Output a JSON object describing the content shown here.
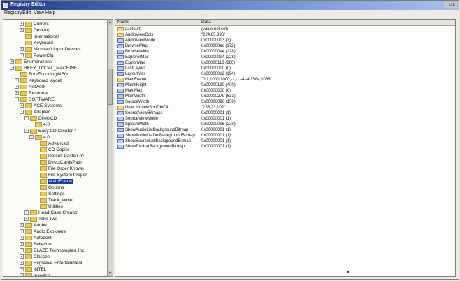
{
  "window": {
    "title": "Registry Editor",
    "caption_buttons": "_ □ x"
  },
  "menu": [
    "Registry",
    "Edit",
    "View",
    "Help"
  ],
  "tree": [
    {
      "label": "Current",
      "indent": 3,
      "exp": "+"
    },
    {
      "label": "Desktop",
      "indent": 3,
      "exp": "+"
    },
    {
      "label": "International",
      "indent": 3,
      "exp": ""
    },
    {
      "label": "Keyboard",
      "indent": 3,
      "exp": ""
    },
    {
      "label": "Microsoft Input Devices",
      "indent": 3,
      "exp": "+"
    },
    {
      "label": "PowerCfg",
      "indent": 3,
      "exp": "+"
    },
    {
      "label": "Enumerations",
      "indent": 1,
      "exp": "+"
    },
    {
      "label": "HKEY_LOCAL_MACHINE",
      "indent": 1,
      "exp": "-"
    },
    {
      "label": "FontEncodingINFO",
      "indent": 2,
      "exp": ""
    },
    {
      "label": "Keyboard layout",
      "indent": 2,
      "exp": "+"
    },
    {
      "label": "Network",
      "indent": 2,
      "exp": "+"
    },
    {
      "label": "Resource",
      "indent": 2,
      "exp": "+"
    },
    {
      "label": "SOFTWARE",
      "indent": 2,
      "exp": "-"
    },
    {
      "label": "ACE Systems",
      "indent": 3,
      "exp": "+"
    },
    {
      "label": "Adaptec",
      "indent": 3,
      "exp": "-"
    },
    {
      "label": "DirectCD",
      "indent": 4,
      "exp": "-"
    },
    {
      "label": "4.0",
      "indent": 5,
      "exp": ""
    },
    {
      "label": "Easy CD Creator 4",
      "indent": 4,
      "exp": "-"
    },
    {
      "label": "4.0",
      "indent": 5,
      "exp": "-"
    },
    {
      "label": "Advanced",
      "indent": 6,
      "exp": ""
    },
    {
      "label": "CD Copier",
      "indent": 6,
      "exp": ""
    },
    {
      "label": "Default Paste Loc",
      "indent": 6,
      "exp": ""
    },
    {
      "label": "DirectCardsPath",
      "indent": 6,
      "exp": ""
    },
    {
      "label": "File Order Known",
      "indent": 6,
      "exp": ""
    },
    {
      "label": "File System Proper",
      "indent": 6,
      "exp": ""
    },
    {
      "label": "MainFrame",
      "indent": 6,
      "exp": "",
      "selected": true
    },
    {
      "label": "Options",
      "indent": 6,
      "exp": ""
    },
    {
      "label": "Settings",
      "indent": 6,
      "exp": ""
    },
    {
      "label": "Track_Writer",
      "indent": 6,
      "exp": ""
    },
    {
      "label": "Utilities",
      "indent": 6,
      "exp": ""
    },
    {
      "label": "Head Case Creator",
      "indent": 4,
      "exp": "+"
    },
    {
      "label": "Take Two",
      "indent": 4,
      "exp": "+"
    },
    {
      "label": "Adobe",
      "indent": 3,
      "exp": "+"
    },
    {
      "label": "Audio Explorers",
      "indent": 3,
      "exp": "+"
    },
    {
      "label": "Autodesk",
      "indent": 3,
      "exp": "+"
    },
    {
      "label": "Bellecom",
      "indent": 3,
      "exp": "+"
    },
    {
      "label": "BLAZE Technologies, Inc",
      "indent": 3,
      "exp": "+"
    },
    {
      "label": "Classes",
      "indent": 3,
      "exp": "+"
    },
    {
      "label": "Hilgraeve Entertainment",
      "indent": 3,
      "exp": "+"
    },
    {
      "label": "INTEL",
      "indent": 3,
      "exp": "+"
    },
    {
      "label": "Ipswitch",
      "indent": 3,
      "exp": "+"
    }
  ],
  "columns": {
    "name": "Name",
    "data": "Data"
  },
  "values": [
    {
      "name": "(Default)",
      "type": "string",
      "data": "(value not set)"
    },
    {
      "name": "AudioViewCols",
      "type": "string",
      "data": "\"224,85,396\""
    },
    {
      "name": "AudioViewMode",
      "type": "binary",
      "data": "0x00000003 (3)"
    },
    {
      "name": "BrowseMap",
      "type": "binary",
      "data": "0x000000ac (172)"
    },
    {
      "name": "BrowseWide",
      "type": "binary",
      "data": "0x000000e4 (228)"
    },
    {
      "name": "ExplorerMax",
      "type": "binary",
      "data": "0x000000e4 (228)"
    },
    {
      "name": "ExplorMax",
      "type": "binary",
      "data": "0x00000118 (280)"
    },
    {
      "name": "LastLayout",
      "type": "binary",
      "data": "0x00000000 (0)"
    },
    {
      "name": "LayoutMax",
      "type": "binary",
      "data": "0x000000c2 (194)"
    },
    {
      "name": "MainFrame",
      "type": "string",
      "data": "\"0,1,1000,1000,-1,-1,-4,-4,1584,1068\""
    },
    {
      "name": "MainHeight",
      "type": "binary",
      "data": "0x00000190 (400)"
    },
    {
      "name": "MainMax",
      "type": "binary",
      "data": "0x00000000 (0)"
    },
    {
      "name": "MainWidth",
      "type": "binary",
      "data": "0x00000279 (633)"
    },
    {
      "name": "SourceWidth",
      "type": "binary",
      "data": "0x00000096 (150)"
    },
    {
      "name": "NewListViewSortDblClk",
      "type": "string",
      "data": "\"186,23,102\""
    },
    {
      "name": "SourceViewBitmaps",
      "type": "binary",
      "data": "0x00000001 (1)"
    },
    {
      "name": "SourceViewMode",
      "type": "binary",
      "data": "0x00000001 (1)"
    },
    {
      "name": "SplashWidth",
      "type": "binary",
      "data": "0x000000e5 (229)"
    },
    {
      "name": "ShowAudioListBackgroundBitmap",
      "type": "binary",
      "data": "0x00000001 (1)"
    },
    {
      "name": "ShowAudioListDefBackgroundBitmap",
      "type": "binary",
      "data": "0x00000001 (1)"
    },
    {
      "name": "ShowSourceListBackgroundBitmap",
      "type": "binary",
      "data": "0x00000001 (1)"
    },
    {
      "name": "ShowToolbarBackgroundBitmap",
      "type": "binary",
      "data": "0x00000001 (1)"
    }
  ]
}
